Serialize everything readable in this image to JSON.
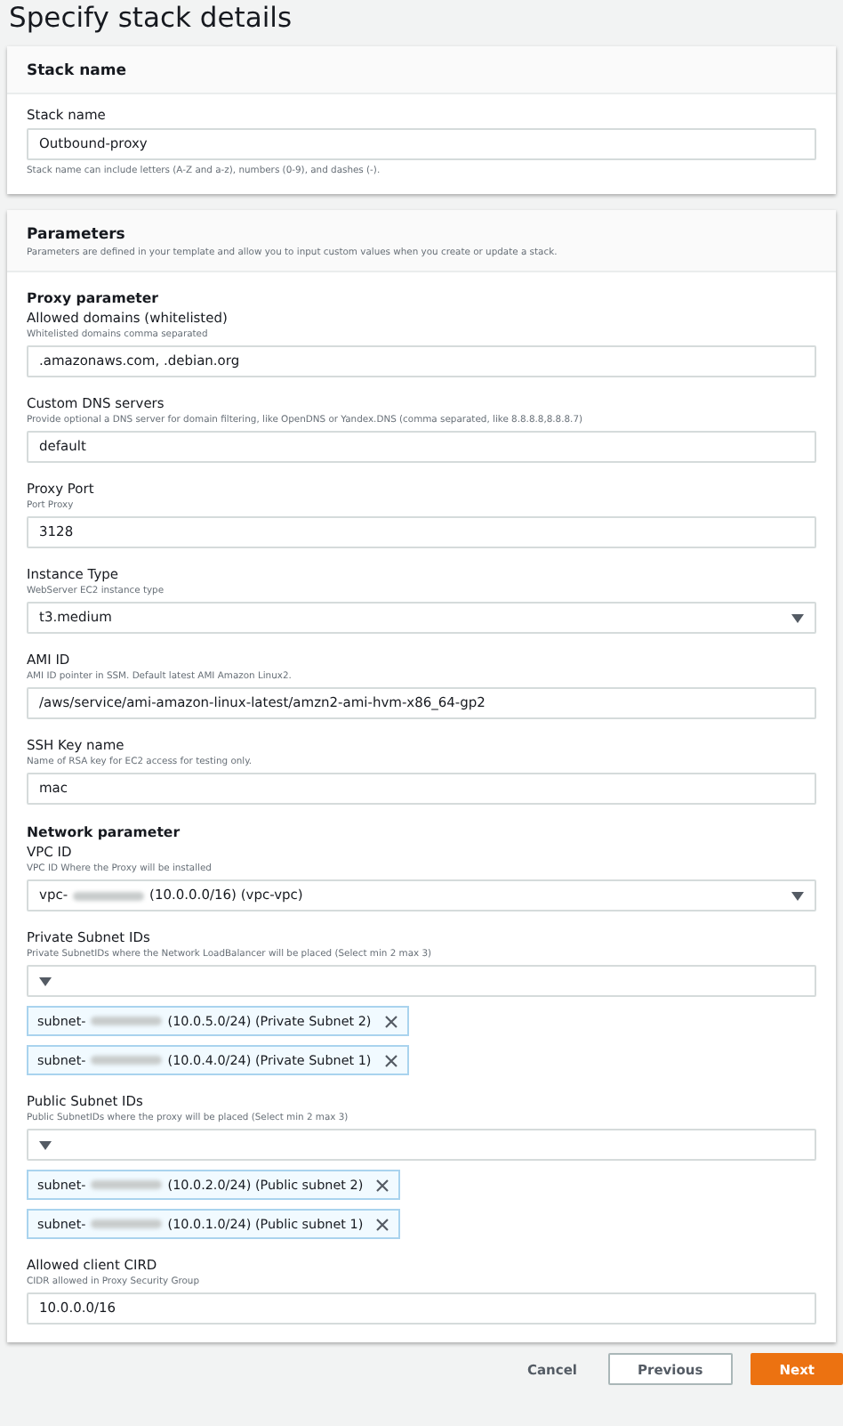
{
  "page_title": "Specify stack details",
  "stack_card": {
    "heading": "Stack name",
    "label": "Stack name",
    "value": "Outbound-proxy",
    "hint": "Stack name can include letters (A-Z and a-z), numbers (0-9), and dashes (-)."
  },
  "parameters": {
    "heading": "Parameters",
    "description": "Parameters are defined in your template and allow you to input custom values when you create or update a stack.",
    "groups": [
      {
        "heading": "Proxy parameter",
        "fields": [
          {
            "label": "Allowed domains (whitelisted)",
            "hint": "Whitelisted domains comma separated",
            "kind": "text",
            "value": ".amazonaws.com, .debian.org"
          },
          {
            "label": "Custom DNS servers",
            "hint": "Provide optional a DNS server for domain filtering, like OpenDNS or Yandex.DNS (comma separated, like 8.8.8.8,8.8.8.7)",
            "kind": "text",
            "value": "default"
          },
          {
            "label": "Proxy Port",
            "hint": "Port Proxy",
            "kind": "text",
            "value": "3128"
          },
          {
            "label": "Instance Type",
            "hint": "WebServer EC2 instance type",
            "kind": "select",
            "value": "t3.medium"
          },
          {
            "label": "AMI ID",
            "hint": "AMI ID pointer in SSM. Default latest AMI Amazon Linux2.",
            "kind": "text",
            "value": "/aws/service/ami-amazon-linux-latest/amzn2-ami-hvm-x86_64-gp2"
          },
          {
            "label": "SSH Key name",
            "hint": "Name of RSA key for EC2 access for testing only.",
            "kind": "text",
            "value": "mac"
          }
        ]
      },
      {
        "heading": "Network parameter",
        "fields": [
          {
            "label": "VPC ID",
            "hint": "VPC ID Where the Proxy will be installed",
            "kind": "select",
            "value_prefix": "vpc-",
            "value_suffix": "(10.0.0.0/16) (vpc-vpc)"
          },
          {
            "label": "Private Subnet IDs",
            "hint": "Private SubnetIDs where the Network LoadBalancer will be placed (Select min 2 max 3)",
            "kind": "multiselect",
            "tokens": [
              {
                "prefix": "subnet-",
                "suffix": "(10.0.5.0/24) (Private Subnet 2)"
              },
              {
                "prefix": "subnet-",
                "suffix": "(10.0.4.0/24) (Private Subnet 1)"
              }
            ]
          },
          {
            "label": "Public Subnet IDs",
            "hint": "Public SubnetIDs where the proxy will be placed (Select min 2 max 3)",
            "kind": "multiselect",
            "tokens": [
              {
                "prefix": "subnet-",
                "suffix": "(10.0.2.0/24) (Public subnet 2)"
              },
              {
                "prefix": "subnet-",
                "suffix": "(10.0.1.0/24) (Public subnet 1)"
              }
            ]
          },
          {
            "label": "Allowed client CIRD",
            "hint": "CIDR allowed in Proxy Security Group",
            "kind": "text",
            "value": "10.0.0.0/16"
          }
        ]
      }
    ]
  },
  "footer": {
    "cancel": "Cancel",
    "previous": "Previous",
    "next": "Next"
  }
}
